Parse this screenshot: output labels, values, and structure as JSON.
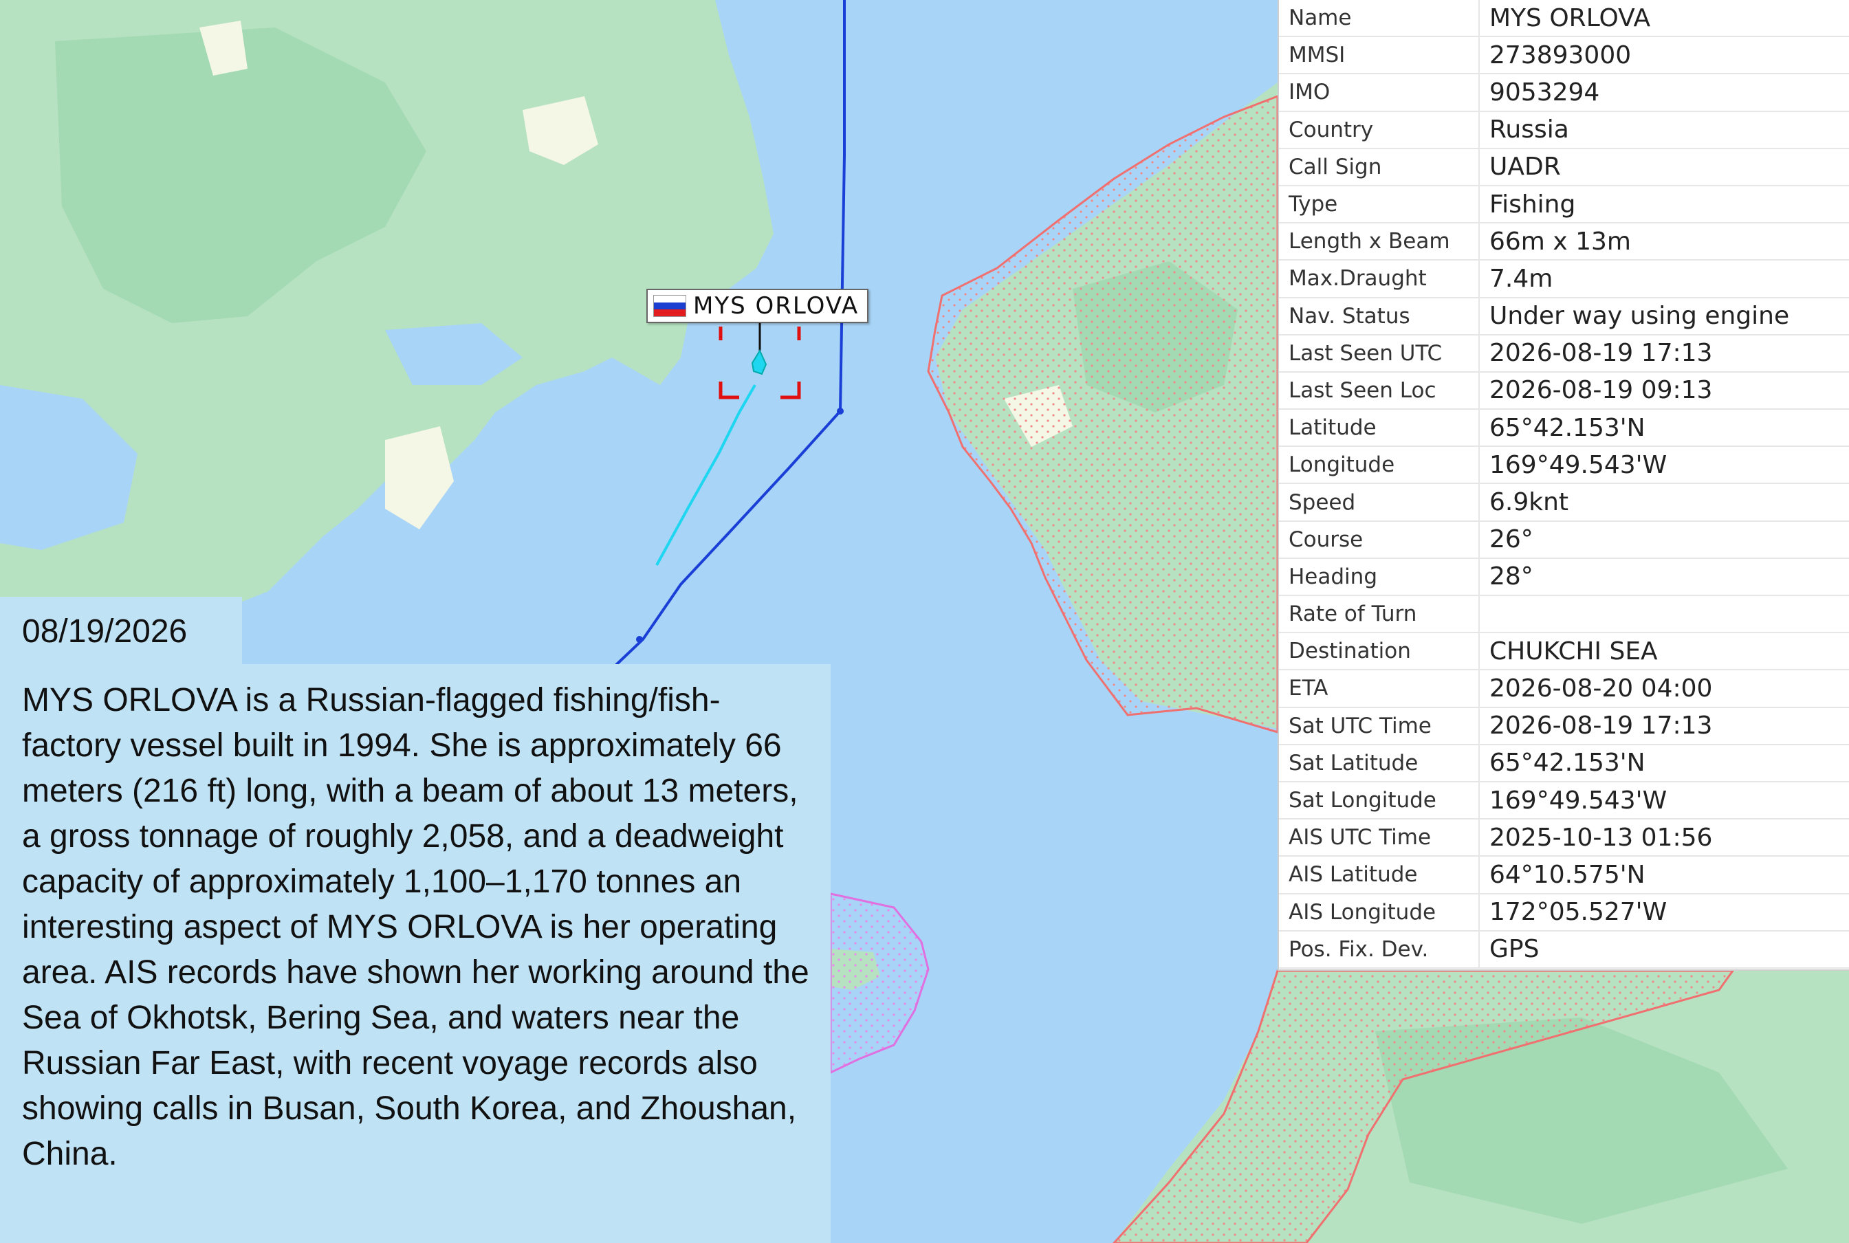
{
  "vessel_label": {
    "name": "MYS ORLOVA",
    "flag_icon": "russia-flag-icon"
  },
  "info_rows": [
    {
      "key": "Name",
      "value": "MYS ORLOVA"
    },
    {
      "key": "MMSI",
      "value": "273893000"
    },
    {
      "key": "IMO",
      "value": "9053294"
    },
    {
      "key": "Country",
      "value": "Russia"
    },
    {
      "key": "Call Sign",
      "value": "UADR"
    },
    {
      "key": "Type",
      "value": "Fishing"
    },
    {
      "key": "Length x Beam",
      "value": "66m x 13m"
    },
    {
      "key": "Max.Draught",
      "value": "7.4m"
    },
    {
      "key": "Nav. Status",
      "value": "Under way using engine"
    },
    {
      "key": "Last Seen UTC",
      "value": "2026-08-19 17:13"
    },
    {
      "key": "Last Seen Loc",
      "value": "2026-08-19 09:13"
    },
    {
      "key": "Latitude",
      "value": "65°42.153'N"
    },
    {
      "key": "Longitude",
      "value": "169°49.543'W"
    },
    {
      "key": "Speed",
      "value": "6.9knt"
    },
    {
      "key": "Course",
      "value": "26°"
    },
    {
      "key": "Heading",
      "value": "28°"
    },
    {
      "key": "Rate of Turn",
      "value": ""
    },
    {
      "key": "Destination",
      "value": "CHUKCHI SEA"
    },
    {
      "key": "ETA",
      "value": "2026-08-20 04:00"
    },
    {
      "key": "Sat UTC Time",
      "value": "2026-08-19 17:13"
    },
    {
      "key": "Sat Latitude",
      "value": "65°42.153'N"
    },
    {
      "key": "Sat Longitude",
      "value": "169°49.543'W"
    },
    {
      "key": "AIS UTC Time",
      "value": "2025-10-13 01:56"
    },
    {
      "key": "AIS Latitude",
      "value": "64°10.575'N"
    },
    {
      "key": "AIS Longitude",
      "value": "172°05.527'W"
    },
    {
      "key": "Pos. Fix. Dev.",
      "value": "GPS"
    }
  ],
  "date": "08/19/2026",
  "description": "MYS ORLOVA is a Russian-flagged fishing/fish-factory vessel built in 1994. She is approximately 66 meters (216 ft) long, with a beam of about 13 meters, a gross tonnage of roughly 2,058, and a deadweight capacity of approximately 1,100–1,170 tonnes an interesting aspect of MYS ORLOVA is her operating area. AIS records have shown her working around the Sea of Okhotsk, Bering Sea, and waters near the Russian Far East, with recent voyage records also showing calls in Busan, South Korea, and Zhoushan, China.",
  "colors": {
    "water": "#a8d4f7",
    "land": "#b6e2c2",
    "track": "#1a3fd6",
    "vessel_track": "#1fd6f0",
    "zone_border": "#f07070",
    "zone_border_magenta": "#e070e0",
    "selection": "#e01010"
  }
}
